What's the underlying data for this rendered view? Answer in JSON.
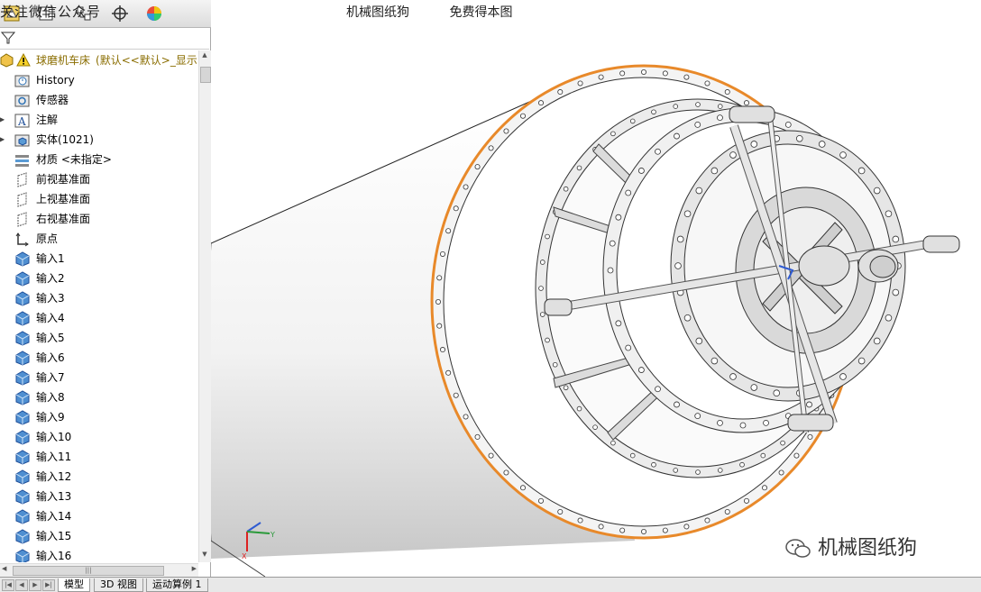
{
  "panel": {
    "top_overlay_text": "关注微信公众号"
  },
  "viewport": {
    "caption_left": "机械图纸狗",
    "caption_right": "免费得本图",
    "watermark": "机械图纸狗"
  },
  "tree": {
    "root": {
      "label": "球磨机车床",
      "config": "(默认<<默认>_显示"
    },
    "items": [
      {
        "label": "History"
      },
      {
        "label": "传感器"
      },
      {
        "label": "注解"
      },
      {
        "label": "实体(1021)"
      },
      {
        "label": "材质 <未指定>"
      },
      {
        "label": "前视基准面"
      },
      {
        "label": "上视基准面"
      },
      {
        "label": "右视基准面"
      },
      {
        "label": "原点"
      },
      {
        "label": "输入1"
      },
      {
        "label": "输入2"
      },
      {
        "label": "输入3"
      },
      {
        "label": "输入4"
      },
      {
        "label": "输入5"
      },
      {
        "label": "输入6"
      },
      {
        "label": "输入7"
      },
      {
        "label": "输入8"
      },
      {
        "label": "输入9"
      },
      {
        "label": "输入10"
      },
      {
        "label": "输入11"
      },
      {
        "label": "输入12"
      },
      {
        "label": "输入13"
      },
      {
        "label": "输入14"
      },
      {
        "label": "输入15"
      },
      {
        "label": "输入16"
      }
    ]
  },
  "bottom_tabs": [
    {
      "label": "模型"
    },
    {
      "label": "3D 视图"
    },
    {
      "label": "运动算例 1"
    }
  ],
  "triad": {
    "x": "X",
    "y": "Y"
  },
  "colors": {
    "selection_edge": "#e8892a",
    "cad_body": "#d8d8d8"
  }
}
